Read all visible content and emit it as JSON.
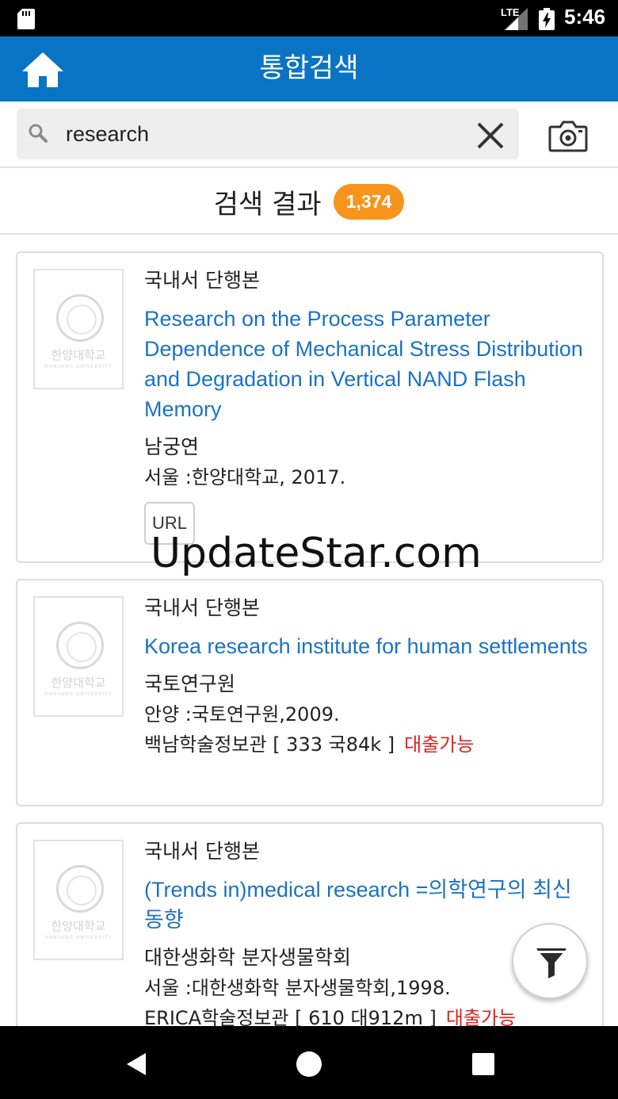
{
  "status_bar": {
    "network": "LTE",
    "time": "5:46",
    "icons": [
      "sd-card-icon",
      "signal-icon",
      "battery-charging-icon"
    ]
  },
  "app_bar": {
    "title": "통합검색",
    "home_icon": "home-icon"
  },
  "search": {
    "value": "research",
    "placeholder": "",
    "search_icon": "search-icon",
    "clear_icon": "close-icon",
    "camera_icon": "camera-icon"
  },
  "results": {
    "label": "검색 결과",
    "count": "1,374"
  },
  "items": [
    {
      "type": "국내서 단행본",
      "title": "Research on the Process Parameter Dependence of Mechanical Stress Distribution and Degradation in Vertical NAND Flash Memory",
      "author": "남궁연",
      "publication": "서울 :한양대학교, 2017.",
      "button": "URL"
    },
    {
      "type": "국내서 단행본",
      "title": "Korea research institute for human settlements",
      "author": "국토연구원",
      "publication": "안양 :국토연구원,2009.",
      "holding": "백남학술정보관 [ 333 국84k ]",
      "availability": "대출가능"
    },
    {
      "type": "국내서 단행본",
      "title": "(Trends in)medical research =의학연구의 최신동향",
      "author": "대한생화학 분자생물학회",
      "publication": "서울 :대한생화학 분자생물학회,1998.",
      "holding": "ERICA학술정보관 [ 610 대912m ]",
      "availability": "대출가능"
    }
  ],
  "thumbnail": {
    "university_name": "한양대학교",
    "university_name_en": "HANYANG UNIVERSITY"
  },
  "watermark": "UpdateStar.com",
  "fab": {
    "icon": "filter-icon"
  },
  "nav_bar": {
    "icons": [
      "back-icon",
      "home-circle-icon",
      "recents-icon"
    ]
  },
  "colors": {
    "app_bar": "#0a74c4",
    "count_badge": "#f7941d",
    "title_link": "#1a73c2",
    "available": "#e0201c"
  }
}
